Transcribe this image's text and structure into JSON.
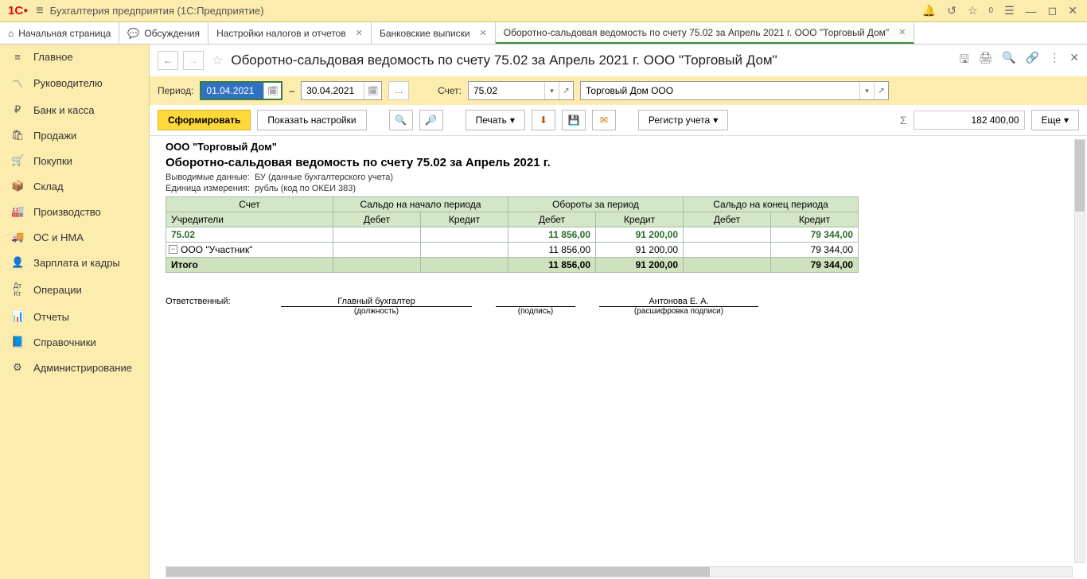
{
  "app": {
    "title": "Бухгалтерия предприятия  (1С:Предприятие)"
  },
  "tabs": {
    "home": "Начальная страница",
    "discuss": "Обсуждения",
    "tax": "Настройки налогов и отчетов",
    "bank": "Банковские выписки",
    "osv": "Оборотно-сальдовая ведомость по счету 75.02 за Апрель 2021 г. ООО \"Торговый Дом\""
  },
  "sidebar": {
    "items": [
      {
        "icon": "≡",
        "label": "Главное"
      },
      {
        "icon": "📈",
        "label": "Руководителю"
      },
      {
        "icon": "₽",
        "label": "Банк и касса"
      },
      {
        "icon": "🛍",
        "label": "Продажи"
      },
      {
        "icon": "🛒",
        "label": "Покупки"
      },
      {
        "icon": "📦",
        "label": "Склад"
      },
      {
        "icon": "🏭",
        "label": "Производство"
      },
      {
        "icon": "🚚",
        "label": "ОС и НМА"
      },
      {
        "icon": "👤",
        "label": "Зарплата и кадры"
      },
      {
        "icon": "Дт",
        "label": "Операции"
      },
      {
        "icon": "📊",
        "label": "Отчеты"
      },
      {
        "icon": "📘",
        "label": "Справочники"
      },
      {
        "icon": "⚙",
        "label": "Администрирование"
      }
    ]
  },
  "page": {
    "title": "Оборотно-сальдовая ведомость по счету 75.02 за Апрель 2021 г. ООО \"Торговый Дом\""
  },
  "params": {
    "period_label": "Период:",
    "date_from": "01.04.2021",
    "dash": "–",
    "date_to": "30.04.2021",
    "account_label": "Счет:",
    "account": "75.02",
    "org": "Торговый Дом ООО"
  },
  "toolbar": {
    "form": "Сформировать",
    "show_settings": "Показать настройки",
    "print": "Печать",
    "register": "Регистр учета",
    "more": "Еще",
    "sum": "182 400,00"
  },
  "report": {
    "org": "ООО \"Торговый Дом\"",
    "title": "Оборотно-сальдовая ведомость по счету 75.02 за Апрель 2021 г.",
    "meta1_label": "Выводимые данные:",
    "meta1_val": "БУ (данные бухгалтерского учета)",
    "meta2_label": "Единица измерения:",
    "meta2_val": "рубль (код по ОКЕИ 383)",
    "headers": {
      "acct": "Счет",
      "founders": "Учредители",
      "start": "Сальдо на начало периода",
      "turn": "Обороты за период",
      "end": "Сальдо на конец периода",
      "debit": "Дебет",
      "credit": "Кредит"
    },
    "rows": [
      {
        "type": "acc",
        "acct": "75.02",
        "sd": "",
        "sc": "",
        "td": "11 856,00",
        "tc": "91 200,00",
        "ed": "",
        "ec": "79 344,00"
      },
      {
        "type": "det",
        "acct": "ООО \"Участник\"",
        "sd": "",
        "sc": "",
        "td": "11 856,00",
        "tc": "91 200,00",
        "ed": "",
        "ec": "79 344,00"
      },
      {
        "type": "tot",
        "acct": "Итого",
        "sd": "",
        "sc": "",
        "td": "11 856,00",
        "tc": "91 200,00",
        "ed": "",
        "ec": "79 344,00"
      }
    ],
    "sig": {
      "resp": "Ответственный:",
      "pos": "Главный бухгалтер",
      "pos_sub": "(должность)",
      "sign_sub": "(подпись)",
      "name": "Антонова Е. А.",
      "name_sub": "(расшифровка подписи)"
    }
  }
}
